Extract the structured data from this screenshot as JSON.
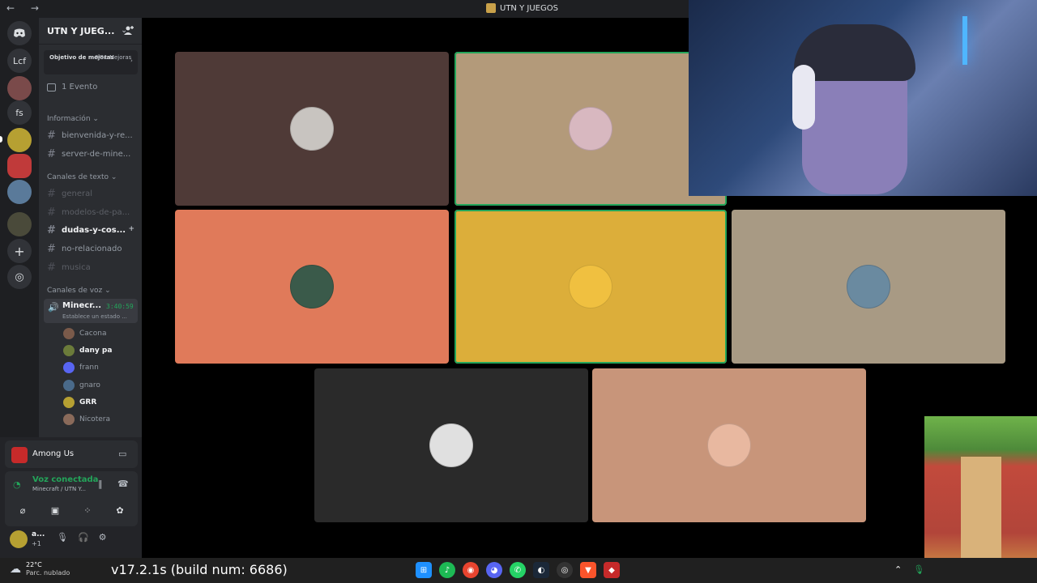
{
  "window": {
    "title": "UTN Y JUEGOS",
    "nav_label": "← →"
  },
  "servers": [
    {
      "label": "Lcf"
    },
    {
      "label": ""
    },
    {
      "label": "fs"
    },
    {
      "label": ""
    },
    {
      "label": ""
    },
    {
      "label": ""
    },
    {
      "label": ""
    }
  ],
  "guild": {
    "name": "UTN Y JUEG...",
    "boost_goal": "Objetivo de mejoras",
    "boost_count": "0/31 Mejoras",
    "event": "1 Evento"
  },
  "categories": {
    "info": "Información",
    "text": "Canales de texto",
    "voice": "Canales de voz"
  },
  "channels": {
    "info": [
      "bienvenida-y-re...",
      "server-de-mine..."
    ],
    "text": [
      {
        "name": "general",
        "state": "muted"
      },
      {
        "name": "modelos-de-pa...",
        "state": "muted"
      },
      {
        "name": "dudas-y-cos...",
        "state": "active"
      },
      {
        "name": "no-relacionado",
        "state": "normal"
      },
      {
        "name": "musica",
        "state": "muted"
      }
    ]
  },
  "voice_channel": {
    "name": "Minecr...",
    "time": "3:40:59",
    "status": "Establece un estado ..."
  },
  "voice_users": [
    {
      "name": "Cacona",
      "bold": false,
      "color": "#7a5a4a"
    },
    {
      "name": "dany pa",
      "bold": true,
      "color": "#6b7b3a"
    },
    {
      "name": "frann",
      "bold": false,
      "color": "#5865f2"
    },
    {
      "name": "gnaro",
      "bold": false,
      "color": "#4a6a8a"
    },
    {
      "name": "GRR",
      "bold": true,
      "color": "#b6a032"
    },
    {
      "name": "Nicotera",
      "bold": false,
      "color": "#8a6a5a"
    }
  ],
  "activity": {
    "game": "Among Us"
  },
  "connection": {
    "status": "Voz conectada",
    "detail": "Minecraft / UTN Y..."
  },
  "user": {
    "name": "a...",
    "sub": "+1"
  },
  "tiles": [
    {
      "color": "#4f3a37",
      "avatar": "#c8c4c0",
      "speaking": false
    },
    {
      "color": "#b39a7a",
      "avatar": "#d8b8c0",
      "speaking": true
    },
    {
      "color": "#e07a5a",
      "avatar": "#3a5a4a",
      "speaking": false
    },
    {
      "color": "#dcae3a",
      "avatar": "#f0c040",
      "speaking": true
    },
    {
      "color": "#a89a84",
      "avatar": "#6a8aa0",
      "speaking": false
    },
    {
      "color": "#2a2a2a",
      "avatar": "#e0e0e0",
      "speaking": false
    },
    {
      "color": "#c8957a",
      "avatar": "#e8b8a0",
      "speaking": false
    }
  ],
  "taskbar": {
    "temp": "22°C",
    "weather": "Parc. nublado",
    "build": "v17.2.1s (build num: 6686)"
  },
  "colors": {
    "accent_green": "#23a55a",
    "blurple": "#5865f2"
  }
}
